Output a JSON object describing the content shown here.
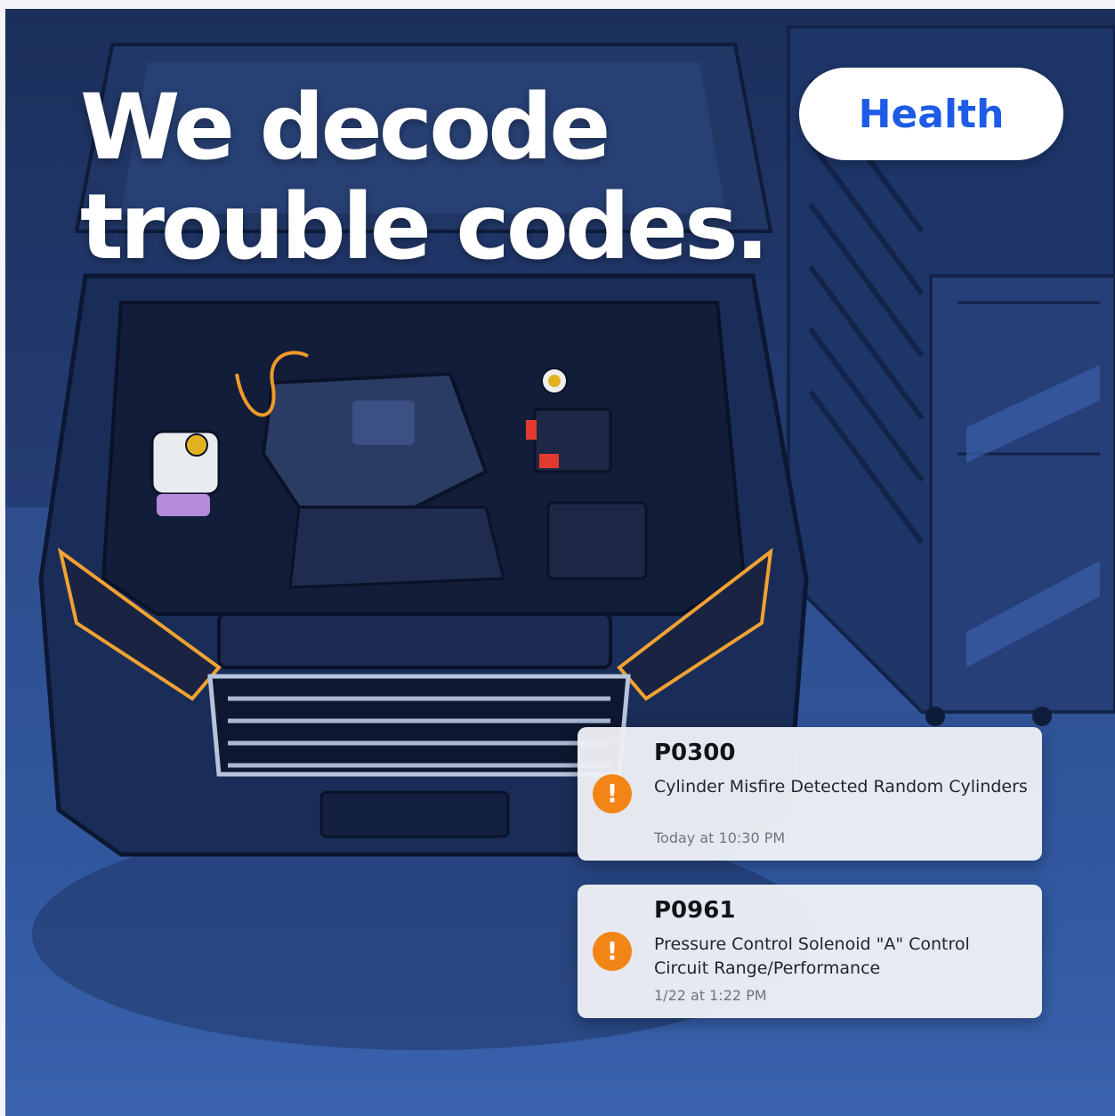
{
  "headline": "We decode\ntrouble codes.",
  "badge": {
    "label": "Health"
  },
  "notifications": [
    {
      "code": "P0300",
      "description": "Cylinder Misfire Detected Random Cylinders",
      "time": "Today at 10:30 PM",
      "icon": "warning-icon"
    },
    {
      "code": "P0961",
      "description": "Pressure Control Solenoid \"A\" Control Circuit Range/Performance",
      "time": "1/22 at 1:22 PM",
      "icon": "warning-icon"
    }
  ],
  "colors": {
    "accent": "#1e5be6",
    "warning": "#f28516",
    "background": "#243d74"
  }
}
